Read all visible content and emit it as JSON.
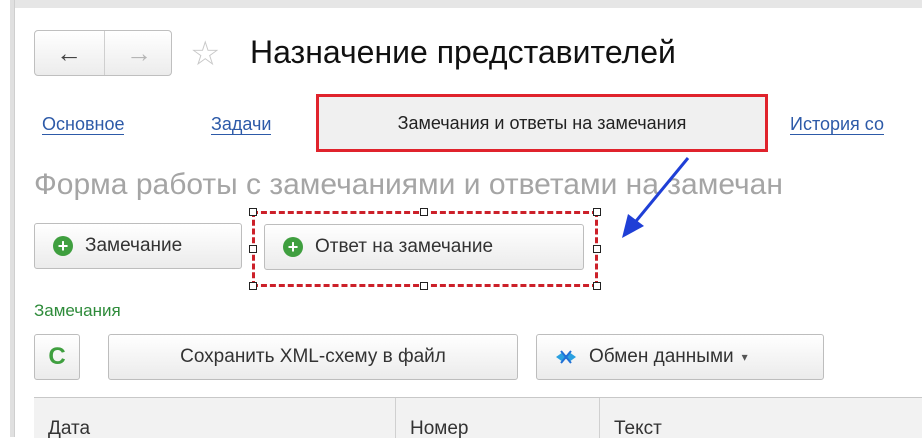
{
  "window": {
    "title": "Назначение представителей",
    "back_icon": "←",
    "forward_icon": "→",
    "favorite_icon": "☆"
  },
  "tabs": [
    {
      "label": "Основное"
    },
    {
      "label": "Задачи"
    },
    {
      "label": "Замечания и ответы на замечания",
      "active": true
    },
    {
      "label": "История со"
    }
  ],
  "form": {
    "title": "Форма работы с замечаниями и ответами на замечан",
    "actions": {
      "remark_label": "Замечание",
      "answer_label": "Ответ на замечание",
      "plus_icon": "+"
    },
    "section_label": "Замечания",
    "toolbar": {
      "refresh_icon": "C",
      "save_xml_label": "Сохранить XML-схему в файл",
      "exchange_label": "Обмен данными",
      "exchange_caret": "▾"
    },
    "table": {
      "columns": [
        "Дата",
        "Номер",
        "Текст"
      ]
    }
  },
  "colors": {
    "highlight": "#e0232c",
    "link": "#2d5aa8",
    "section": "#2e8b3a",
    "arrow": "#1f3fd6"
  }
}
